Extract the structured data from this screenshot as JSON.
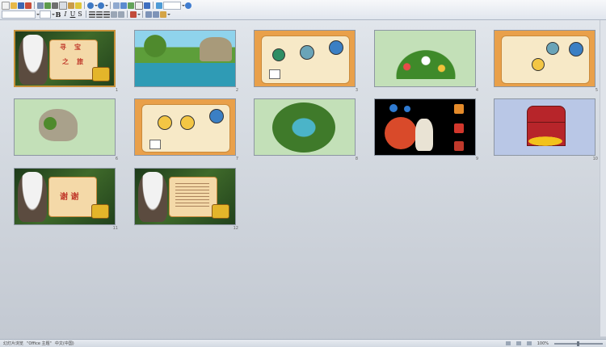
{
  "window": {
    "accent": "#c6913a",
    "background": "#d8dde4"
  },
  "toolbar": {
    "row1_icons": [
      "new-icon",
      "open-icon",
      "save-icon",
      "print-icon",
      "print-preview-icon",
      "spelling-icon",
      "cut-icon",
      "copy-icon",
      "paste-icon",
      "format-painter-icon",
      "undo-icon",
      "redo-icon",
      "insert-table-icon",
      "insert-chart-icon",
      "insert-picture-icon",
      "insert-textbox-icon",
      "insert-wordart-icon",
      "hyperlink-icon",
      "zoom-icon",
      "help-icon"
    ],
    "row2_labels": {
      "bold": "B",
      "italic": "I",
      "underline": "U",
      "shadow": "S"
    }
  },
  "slides": [
    {
      "num": "1",
      "theme": "pirate-title"
    },
    {
      "num": "2",
      "theme": "forest-lake"
    },
    {
      "num": "3",
      "theme": "map-scroll"
    },
    {
      "num": "4",
      "theme": "flowers"
    },
    {
      "num": "5",
      "theme": "map-scroll-2"
    },
    {
      "num": "6",
      "theme": "rock"
    },
    {
      "num": "7",
      "theme": "map-sad-faces"
    },
    {
      "num": "8",
      "theme": "river-oval"
    },
    {
      "num": "9",
      "theme": "genie-lamp"
    },
    {
      "num": "10",
      "theme": "treasure-chest"
    },
    {
      "num": "11",
      "theme": "thanks"
    },
    {
      "num": "12",
      "theme": "text-scroll"
    }
  ],
  "slide_text": {
    "title_chars": [
      "寻",
      "宝",
      "之",
      "旅"
    ],
    "thanks": "谢  谢"
  },
  "statusbar": {
    "view": "幻灯片浏览",
    "theme": "\"Office 主题\"",
    "language": "中文(中国)",
    "zoom": "100%"
  }
}
